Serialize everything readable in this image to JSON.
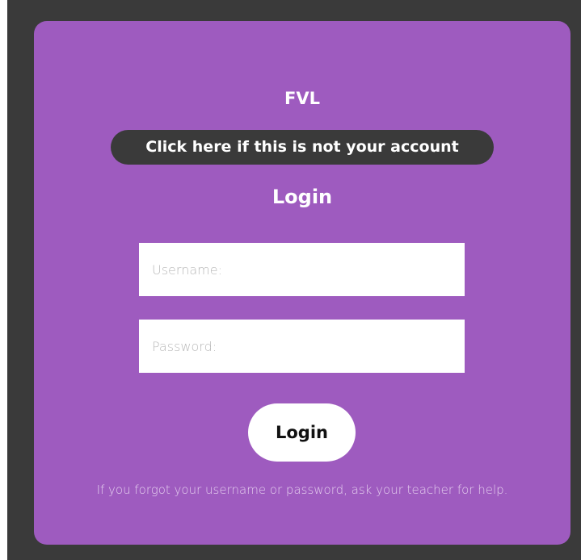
{
  "site": {
    "title": "FVL"
  },
  "account": {
    "switch_label": "Click here if this is not your account"
  },
  "login": {
    "heading": "Login",
    "username_placeholder": "Username:",
    "password_placeholder": "Password:",
    "username_value": "",
    "password_value": "",
    "submit_label": "Login",
    "help_text": "If you forgot your username or password, ask your teacher for help."
  },
  "colors": {
    "background": "#3a3a3a",
    "card": "#9e5bbf",
    "button_dark": "#3a3a3a",
    "text_light": "#ffffff"
  }
}
